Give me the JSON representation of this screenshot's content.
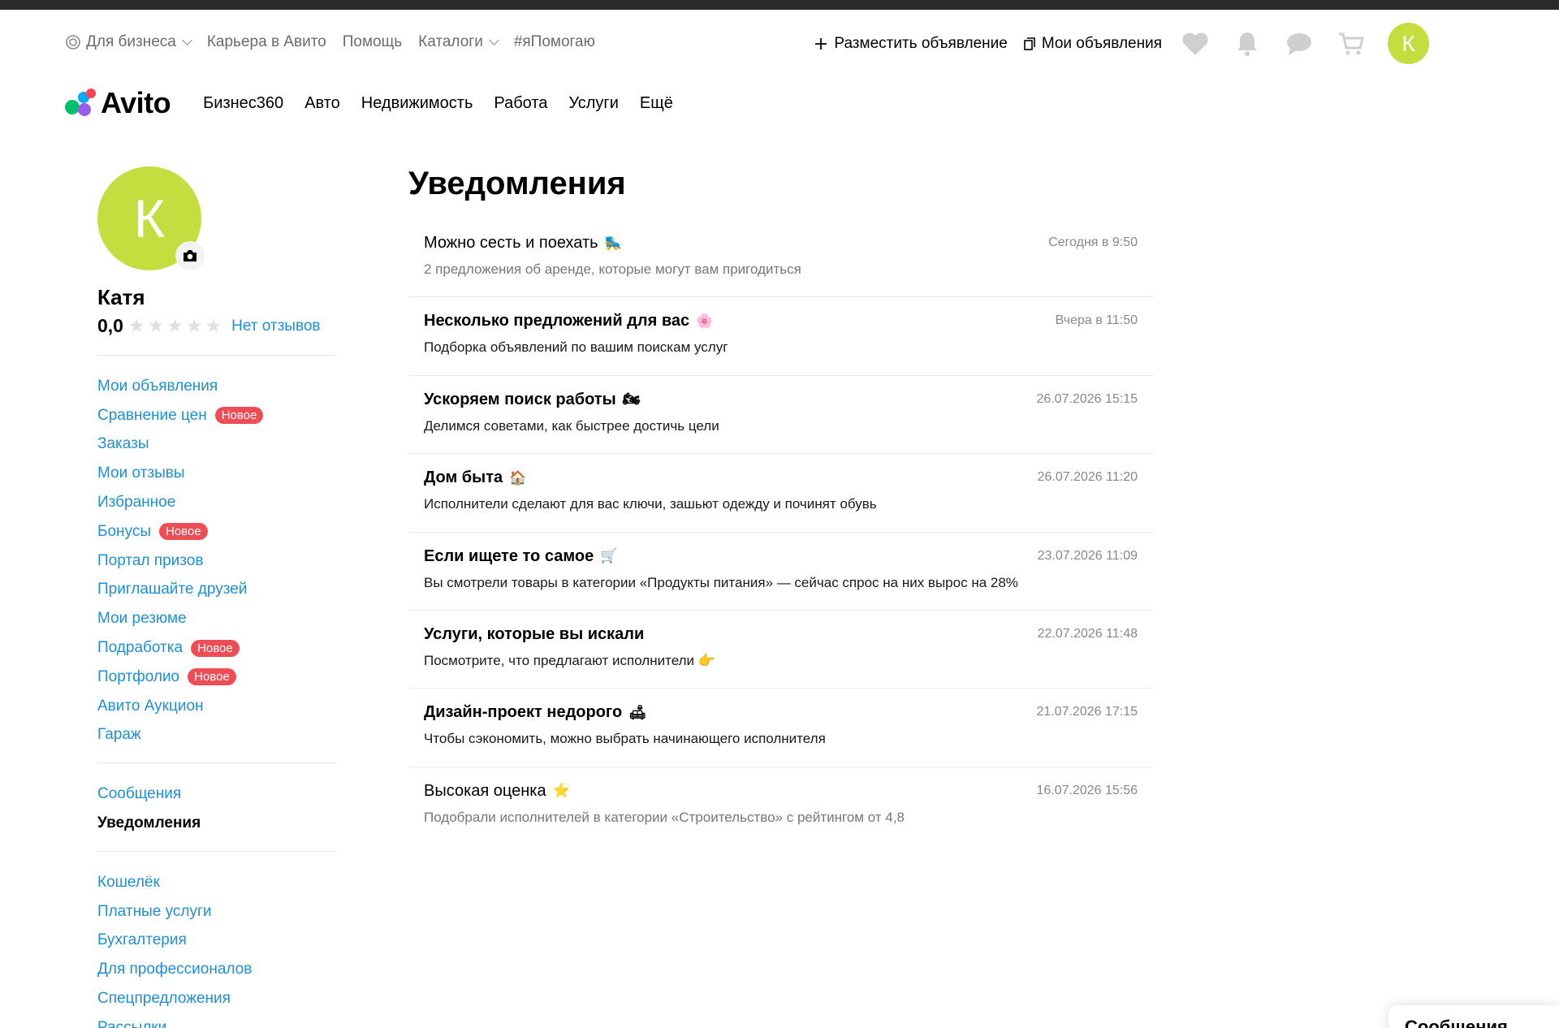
{
  "topbar": {
    "business": "Для бизнеса",
    "career": "Карьера в Авито",
    "help": "Помощь",
    "catalogs": "Каталоги",
    "ihelp": "#яПомогаю",
    "post_ad": "Разместить объявление",
    "my_ads": "Мои объявления",
    "avatar_letter": "К"
  },
  "logo": {
    "text": "Avito"
  },
  "main_nav": [
    "Бизнес360",
    "Авто",
    "Недвижимость",
    "Работа",
    "Услуги",
    "Ещё"
  ],
  "profile": {
    "avatar_letter": "К",
    "name": "Катя",
    "rating": "0,0",
    "no_reviews": "Нет отзывов"
  },
  "sidebar": {
    "group1": [
      {
        "label": "Мои объявления"
      },
      {
        "label": "Сравнение цен",
        "badge": "Новое"
      },
      {
        "label": "Заказы"
      },
      {
        "label": "Мои отзывы"
      },
      {
        "label": "Избранное"
      },
      {
        "label": "Бонусы",
        "badge": "Новое"
      },
      {
        "label": "Портал призов"
      },
      {
        "label": "Приглашайте друзей"
      },
      {
        "label": "Мои резюме"
      },
      {
        "label": "Подработка",
        "badge": "Новое"
      },
      {
        "label": "Портфолио",
        "badge": "Новое"
      },
      {
        "label": "Авито Аукцион"
      },
      {
        "label": "Гараж"
      }
    ],
    "group2": [
      {
        "label": "Сообщения"
      },
      {
        "label": "Уведомления",
        "active": true
      }
    ],
    "group3": [
      {
        "label": "Кошелёк"
      },
      {
        "label": "Платные услуги"
      },
      {
        "label": "Бухгалтерия"
      },
      {
        "label": "Для профессионалов"
      },
      {
        "label": "Спецпредложения"
      },
      {
        "label": "Рассылки"
      }
    ]
  },
  "page": {
    "title": "Уведомления"
  },
  "notifications": [
    {
      "title": "Можно сесть и поехать",
      "emoji": "🛼",
      "subtitle": "2 предложения об аренде, которые могут вам пригодиться",
      "time": "Сегодня в 9:50",
      "unread": false
    },
    {
      "title": "Несколько предложений для вас",
      "emoji": "🌸",
      "subtitle": "Подборка объявлений по вашим поискам услуг",
      "time": "Вчера в 11:50",
      "unread": true
    },
    {
      "title": "Ускоряем поиск работы",
      "emoji": "🏍",
      "subtitle": "Делимся советами, как быстрее достичь цели",
      "time": "26.07.2026 15:15",
      "unread": true
    },
    {
      "title": "Дом быта",
      "emoji": "🏠",
      "subtitle": "Исполнители сделают для вас ключи, зашьют одежду и починят обувь",
      "time": "26.07.2026 11:20",
      "unread": true
    },
    {
      "title": "Если ищете то самое",
      "emoji": "🛒",
      "subtitle": "Вы смотрели товары в категории «Продукты питания» — сейчас спрос на них вырос на 28%",
      "time": "23.07.2026 11:09",
      "unread": true
    },
    {
      "title": "Услуги, которые вы искали",
      "emoji": "",
      "subtitle": "Посмотрите, что предлагают исполнители 👉",
      "time": "22.07.2026 11:48",
      "unread": true
    },
    {
      "title": "Дизайн-проект недорого",
      "emoji": "🛋",
      "subtitle": "Чтобы сэкономить, можно выбрать начинающего исполнителя",
      "time": "21.07.2026 17:15",
      "unread": true
    },
    {
      "title": "Высокая оценка",
      "emoji": "⭐",
      "subtitle": "Подобрали исполнителей в категории «Строительство» с рейтингом от 4,8",
      "time": "16.07.2026 15:56",
      "unread": false
    }
  ],
  "chat_tab": {
    "label": "Сообщения"
  },
  "colors": {
    "accent_link": "#1e8fd8",
    "avatar": "#c5dd3f",
    "badge": "#ef4d55"
  }
}
